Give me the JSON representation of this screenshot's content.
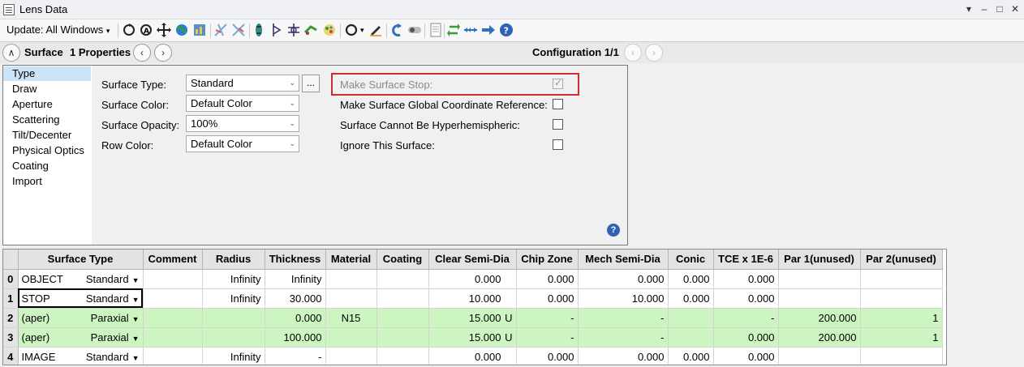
{
  "window": {
    "title": "Lens Data",
    "controls": [
      "▾",
      "–",
      "□",
      "✕"
    ]
  },
  "toolbar": {
    "update_label": "Update: All Windows",
    "icons": [
      "refresh-icon",
      "auto-update-icon",
      "move-icon",
      "globe-icon",
      "chart-icon",
      "scale-icon",
      "reverse-icon",
      "lens-icon",
      "tilt-icon",
      "decenter-icon",
      "ray-icon",
      "pupil-icon",
      "zoom-circle-icon",
      "pen-icon",
      "undo-icon",
      "toggle-icon",
      "page-icon",
      "swap-icon",
      "arrows-icon",
      "right-arrow-icon",
      "help-icon"
    ]
  },
  "surface_bar": {
    "surface_label": "Surface",
    "properties_label": "1 Properties",
    "configuration_label": "Configuration 1/1"
  },
  "panel": {
    "categories": [
      "Type",
      "Draw",
      "Aperture",
      "Scattering",
      "Tilt/Decenter",
      "Physical Optics",
      "Coating",
      "Import"
    ],
    "selected_category": "Type",
    "fields": {
      "surface_type": {
        "label": "Surface Type:",
        "value": "Standard"
      },
      "surface_color": {
        "label": "Surface Color:",
        "value": "Default Color"
      },
      "surface_opacity": {
        "label": "Surface Opacity:",
        "value": "100%"
      },
      "row_color": {
        "label": "Row Color:",
        "value": "Default Color"
      }
    },
    "ellipsis_label": "...",
    "checkboxes": {
      "make_stop": {
        "label": "Make Surface Stop:",
        "checked": true,
        "disabled": true
      },
      "global_ref": {
        "label": "Make Surface Global Coordinate Reference:",
        "checked": false
      },
      "hyperhemispheric": {
        "label": "Surface Cannot Be Hyperhemispheric:",
        "checked": false
      },
      "ignore": {
        "label": "Ignore This Surface:",
        "checked": false
      }
    },
    "help_label": "?"
  },
  "grid": {
    "headers": [
      "",
      "Surface Type",
      "Comment",
      "Radius",
      "Thickness",
      "Material",
      "Coating",
      "Clear Semi-Dia",
      "Chip Zone",
      "Mech Semi-Dia",
      "Conic",
      "TCE x 1E-6",
      "Par 1(unused)",
      "Par 2(unused)"
    ],
    "rows": [
      {
        "num": "0",
        "name": "OBJECT",
        "type": "Standard",
        "comment": "",
        "radius": "Infinity",
        "thickness": "Infinity",
        "t_flag": "",
        "material": "",
        "coating": "",
        "clear": "0.000",
        "clear_flag": "",
        "chip": "0.000",
        "mech": "0.000",
        "conic": "0.000",
        "tce": "0.000",
        "par1": "",
        "par2": "",
        "green": false
      },
      {
        "num": "1",
        "name": "STOP",
        "type": "Standard",
        "comment": "",
        "radius": "Infinity",
        "thickness": "30.000",
        "t_flag": "",
        "material": "",
        "coating": "",
        "clear": "10.000",
        "clear_flag": "",
        "chip": "0.000",
        "mech": "10.000",
        "conic": "0.000",
        "tce": "0.000",
        "par1": "",
        "par2": "",
        "green": false
      },
      {
        "num": "2",
        "name": "(aper)",
        "type": "Paraxial",
        "comment": "",
        "radius": "",
        "thickness": "0.000",
        "t_flag": "",
        "material": "N15",
        "coating": "",
        "clear": "15.000",
        "clear_flag": "U",
        "chip": "-",
        "mech": "-",
        "conic": "",
        "tce": "-",
        "par1": "200.000",
        "par2": "1",
        "green": true
      },
      {
        "num": "3",
        "name": "(aper)",
        "type": "Paraxial",
        "comment": "",
        "radius": "",
        "thickness": "100.000",
        "t_flag": "",
        "material": "",
        "coating": "",
        "clear": "15.000",
        "clear_flag": "U",
        "chip": "-",
        "mech": "-",
        "conic": "",
        "tce": "0.000",
        "par1": "200.000",
        "par2": "1",
        "green": true
      },
      {
        "num": "4",
        "name": "IMAGE",
        "type": "Standard",
        "comment": "",
        "radius": "Infinity",
        "thickness": "-",
        "t_flag": "",
        "material": "",
        "coating": "",
        "clear": "0.000",
        "clear_flag": "",
        "chip": "0.000",
        "mech": "0.000",
        "conic": "0.000",
        "tce": "0.000",
        "par1": "",
        "par2": "",
        "green": false
      }
    ]
  }
}
